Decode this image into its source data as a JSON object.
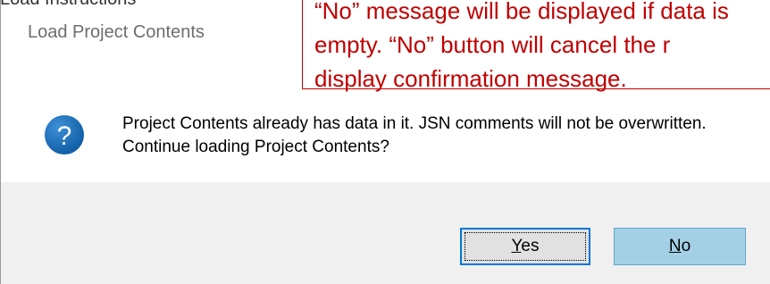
{
  "background": {
    "partial_text": "Load Instructions"
  },
  "dialog": {
    "title": "Load Project Contents",
    "icon": "question-icon",
    "message": "Project Contents already has data in it.  JSN comments will not be overwritten.  Continue loading Project Contents?",
    "buttons": {
      "yes_label": "Yes",
      "yes_accel": "Y",
      "yes_rest": "es",
      "no_label": "No",
      "no_accel": "N",
      "no_rest": "o"
    }
  },
  "annotation": {
    "lines": [
      "“No” message will be displayed if data is",
      "empty.  “No” button will cancel the r",
      "display confirmation message."
    ],
    "color": "#c00000"
  },
  "colors": {
    "icon_blue": "#1e6fb5",
    "focus_border": "#0078d7",
    "no_button_bg": "#a4d0e6",
    "footer_bg": "#f0f0f0"
  }
}
